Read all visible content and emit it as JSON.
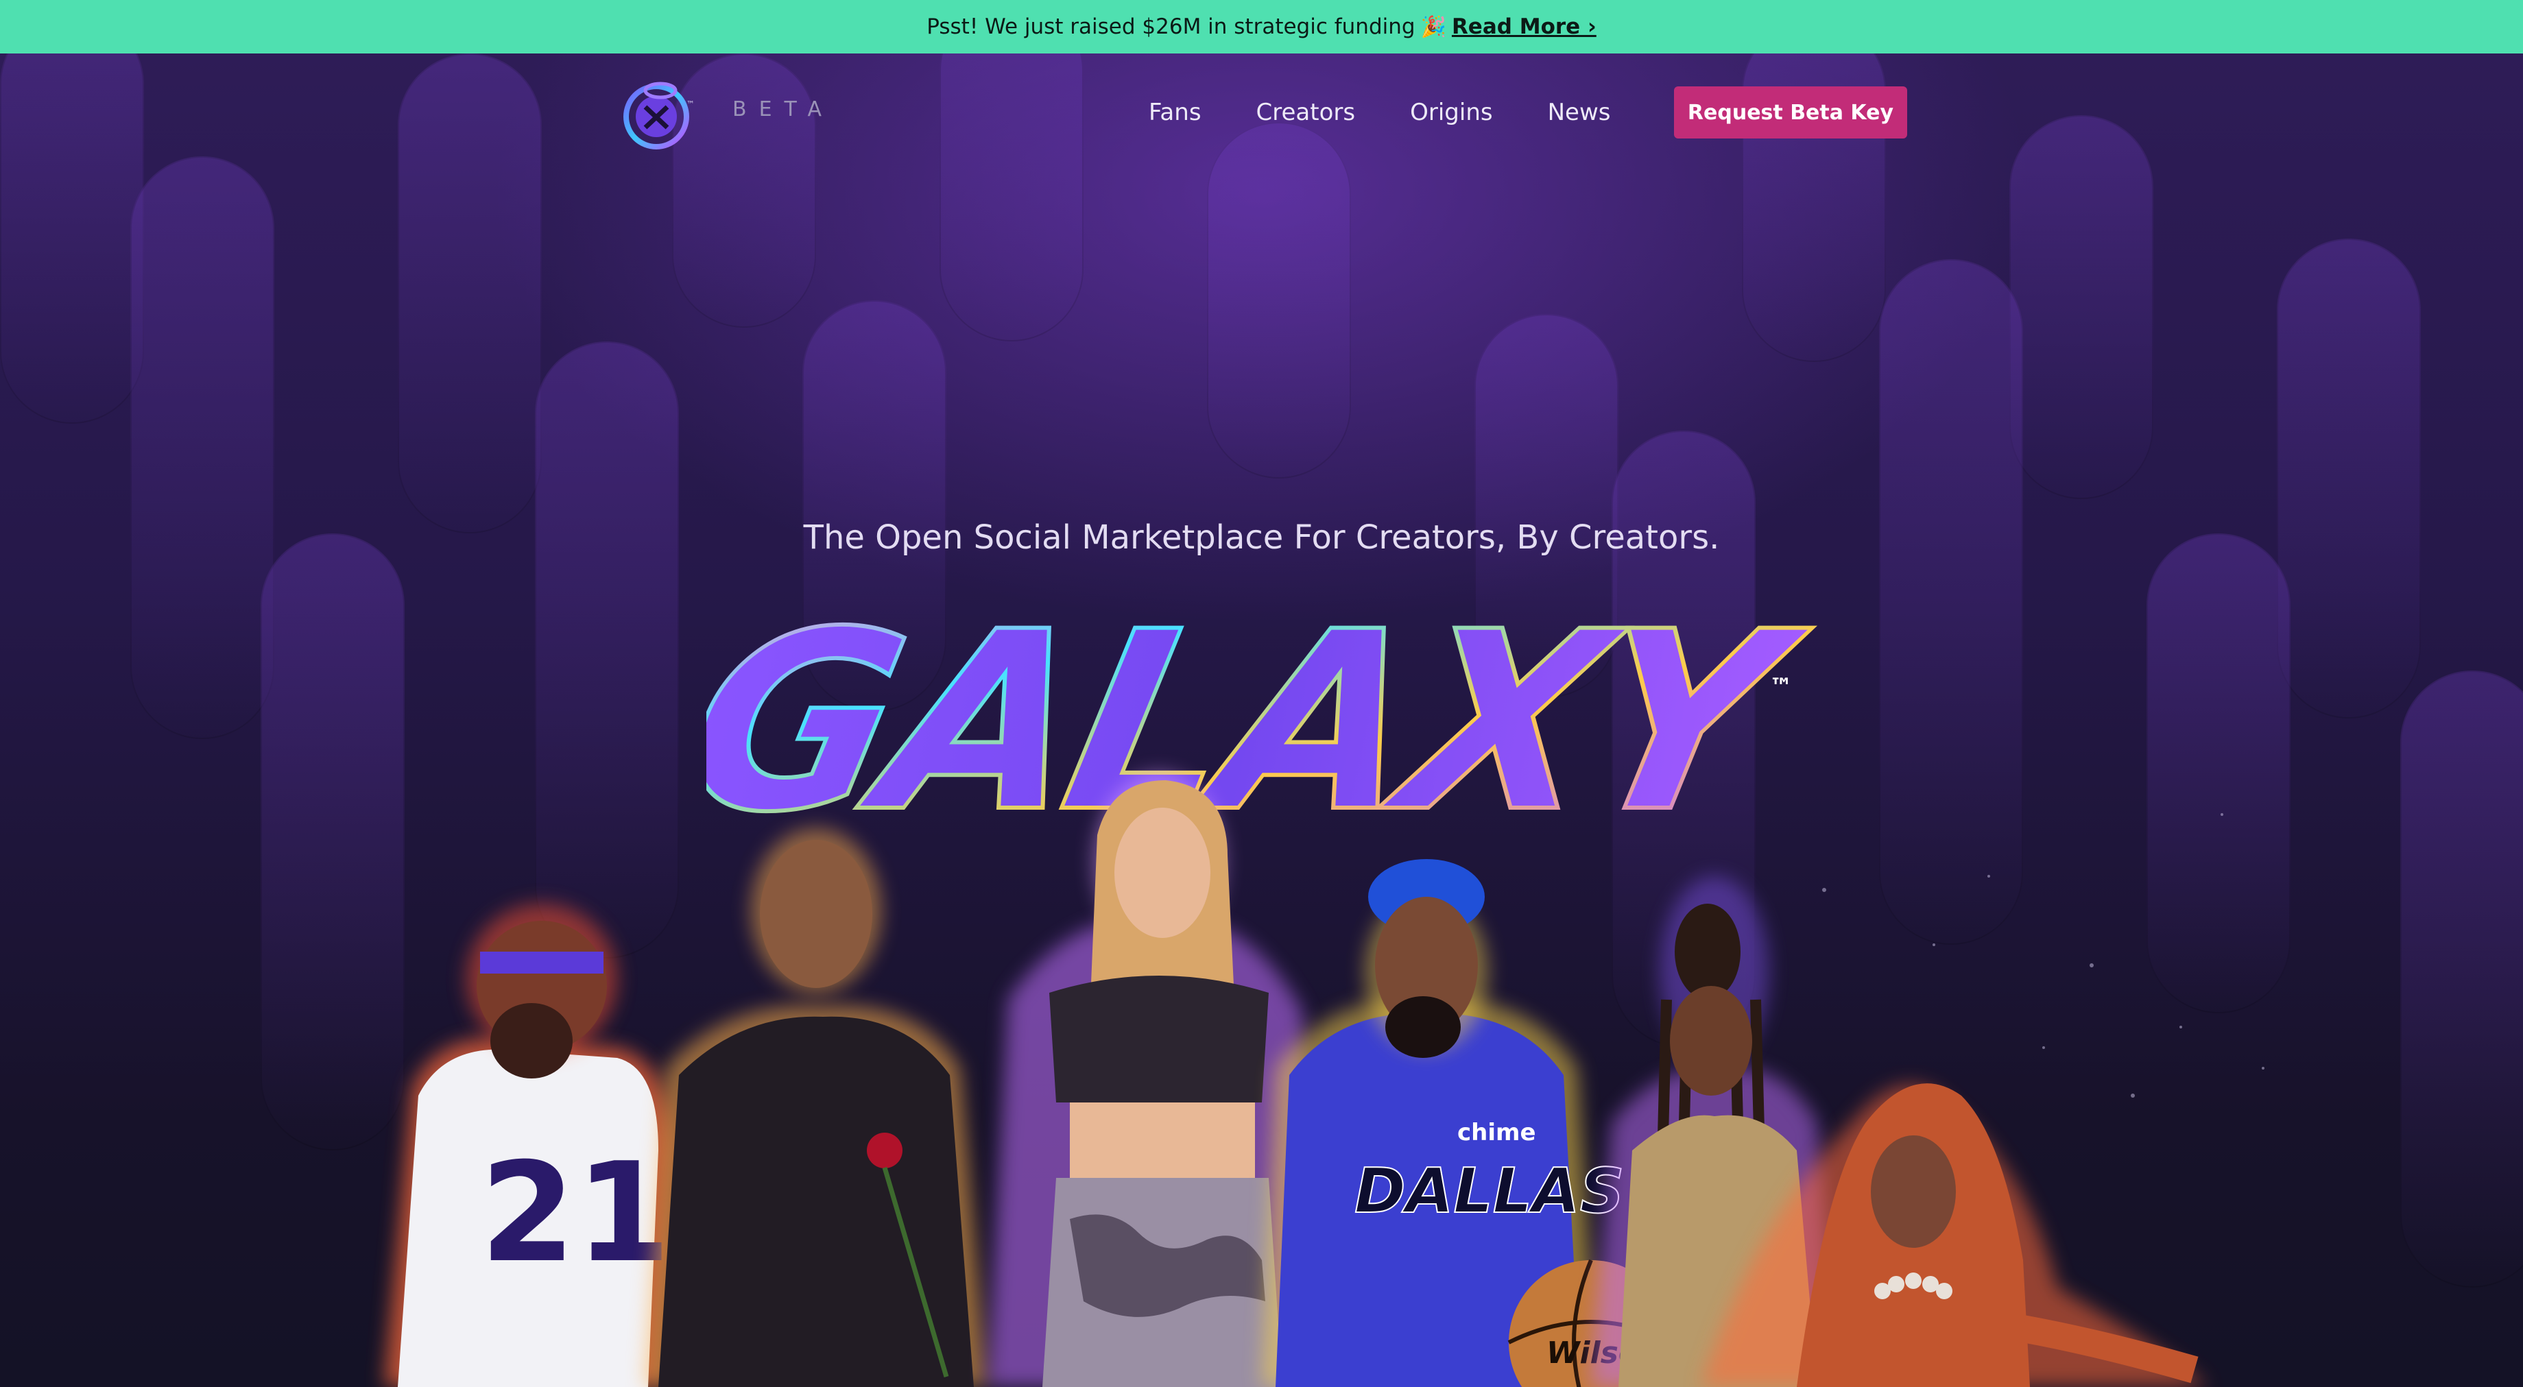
{
  "announcement": {
    "text": "Psst! We just raised $26M in strategic funding",
    "emoji": "🎉",
    "link": "Read More ›"
  },
  "header": {
    "logo_tm": "™",
    "beta_label": "BETA",
    "nav": [
      "Fans",
      "Creators",
      "Origins",
      "News"
    ],
    "cta_label": "Request Beta Key"
  },
  "hero": {
    "tagline": "The Open Social Marketplace For Creators, By Creators.",
    "wordmark": "GALAXY",
    "wordmark_tm": "™",
    "jersey_numbers": {
      "football": "21",
      "basketball_team": "DALLAS",
      "basketball_sponsor": "chime",
      "ball_brand": "Wilson"
    }
  },
  "colors": {
    "banner": "#4fe0b0",
    "cta": "#c22c78",
    "background": "#241848",
    "wordmark_gradient_start": "#7a4bff",
    "wordmark_gradient_end": "#b45cff"
  }
}
